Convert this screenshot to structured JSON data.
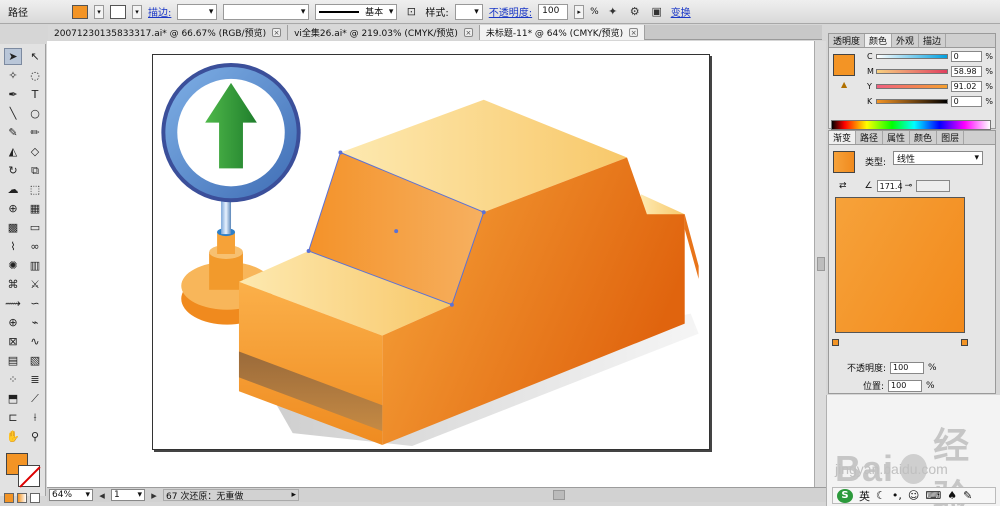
{
  "topbar": {
    "object_label": "路径",
    "stroke_link": "描边:",
    "stroke_style": "基本",
    "style_label": "样式:",
    "opacity_link": "不透明度:",
    "opacity_value": "100",
    "opacity_unit": "%",
    "transform_link": "变换"
  },
  "tabs": [
    {
      "label": "20071230135833317.ai* @ 66.67% (RGB/预览)"
    },
    {
      "label": "vi全集26.ai* @ 219.03% (CMYK/预览)"
    },
    {
      "label": "未标题-11* @ 64% (CMYK/预览)"
    }
  ],
  "color_panel": {
    "tabs": [
      "透明度",
      "颜色",
      "外观",
      "描边"
    ],
    "channels": [
      {
        "label": "C",
        "value": "0",
        "unit": "%"
      },
      {
        "label": "M",
        "value": "58.98",
        "unit": "%"
      },
      {
        "label": "Y",
        "value": "91.02",
        "unit": "%"
      },
      {
        "label": "K",
        "value": "0",
        "unit": "%"
      }
    ]
  },
  "gradient_panel": {
    "tabs": [
      "渐变",
      "路径",
      "属性",
      "颜色",
      "图层"
    ],
    "type_label": "类型:",
    "type_value": "线性",
    "angle_value": "171.4",
    "opacity_label": "不透明度:",
    "opacity_value": "100",
    "location_label": "位置:",
    "location_value": "100",
    "unit": "%"
  },
  "statusbar": {
    "zoom": "64%",
    "page": "1",
    "history": "67 次还原：无重做"
  },
  "watermark": {
    "logo_text": "Bai",
    "logo_text_2": "经验",
    "url": "jingyan.baidu.com"
  },
  "ime": {
    "mode": "英"
  },
  "colors": {
    "fill": "#f39425",
    "accent_link": "#1a37c7"
  }
}
